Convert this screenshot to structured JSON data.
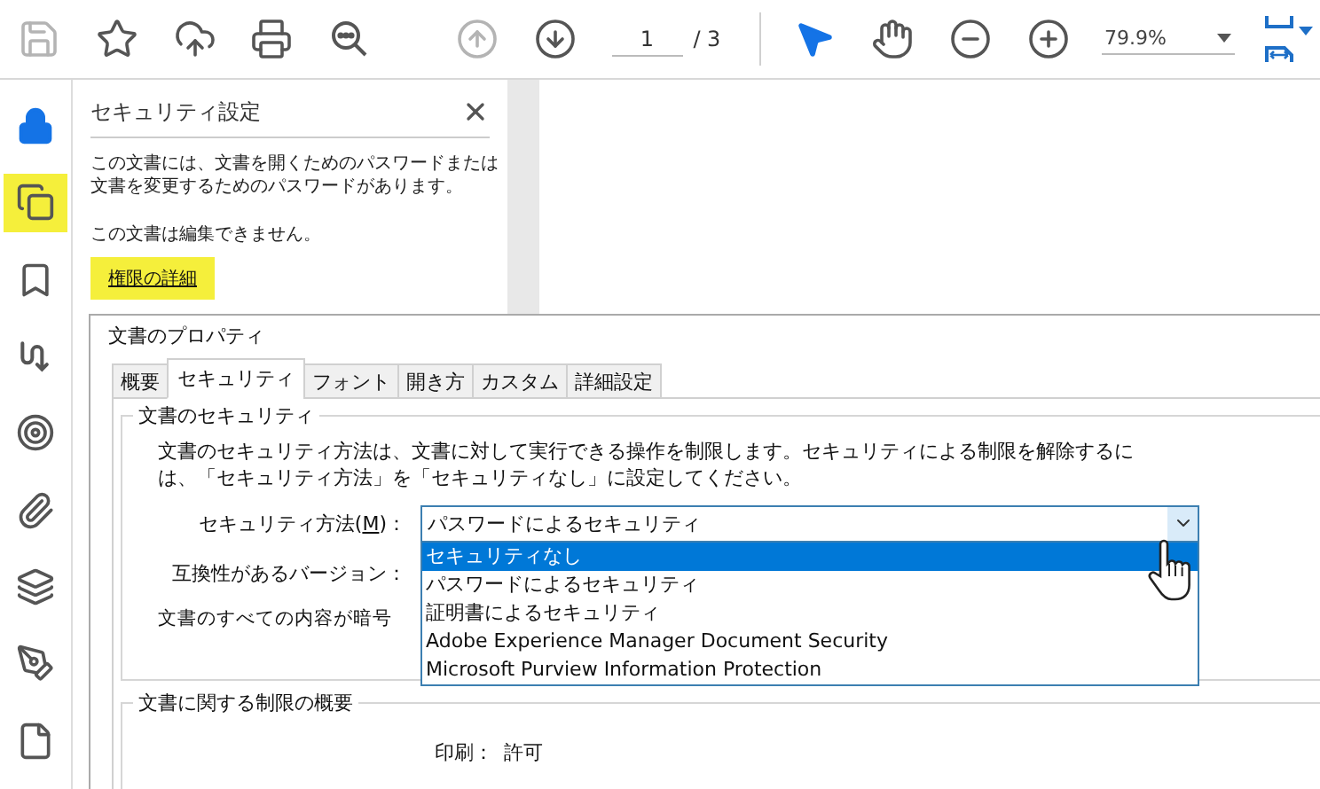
{
  "toolbar": {
    "tools": [
      {
        "kind": "save",
        "disabled": true,
        "selected": false
      },
      {
        "kind": "star",
        "disabled": false,
        "selected": false
      },
      {
        "kind": "upload",
        "disabled": false,
        "selected": false
      },
      {
        "kind": "print",
        "disabled": false,
        "selected": false
      },
      {
        "kind": "search",
        "disabled": false,
        "selected": false
      }
    ],
    "nav": [
      {
        "kind": "up",
        "disabled": true,
        "selected": false
      },
      {
        "kind": "down",
        "disabled": false,
        "selected": false
      }
    ],
    "page": {
      "current": "1",
      "total": "/ 3"
    },
    "view": [
      {
        "kind": "pointer",
        "disabled": false,
        "selected": true
      },
      {
        "kind": "hand",
        "disabled": false,
        "selected": false
      },
      {
        "kind": "zoom-out",
        "disabled": false,
        "selected": false
      },
      {
        "kind": "zoom-in",
        "disabled": false,
        "selected": false
      }
    ],
    "zoom": "79.9%"
  },
  "sidebar": {
    "items": [
      {
        "kind": "lock",
        "selected": true,
        "highlighted": false
      },
      {
        "kind": "copy",
        "selected": false,
        "highlighted": true
      },
      {
        "kind": "bookmark",
        "selected": false,
        "highlighted": false
      },
      {
        "kind": "squiggle",
        "selected": false,
        "highlighted": false
      },
      {
        "kind": "target",
        "selected": false,
        "highlighted": false
      },
      {
        "kind": "paperclip",
        "selected": false,
        "highlighted": false
      },
      {
        "kind": "layers",
        "selected": false,
        "highlighted": false
      },
      {
        "kind": "pen",
        "selected": false,
        "highlighted": false
      },
      {
        "kind": "file",
        "selected": false,
        "highlighted": false
      }
    ]
  },
  "security_panel": {
    "title": "セキュリティ設定",
    "description": "この文書には、文書を開くためのパスワードまたは文書を変更するためのパスワードがあります。",
    "note": "この文書は編集できません。",
    "link": {
      "label": "権限の詳細",
      "highlighted": true
    }
  },
  "dialog": {
    "title": "文書のプロパティ",
    "tabs": [
      {
        "label": "概要",
        "selected": false
      },
      {
        "label": "セキュリティ",
        "selected": true
      },
      {
        "label": "フォント",
        "selected": false
      },
      {
        "label": "開き方",
        "selected": false
      },
      {
        "label": "カスタム",
        "selected": false
      },
      {
        "label": "詳細設定",
        "selected": false
      }
    ],
    "security_group": {
      "title": "文書のセキュリティ",
      "description": [
        "文書のセキュリティ方法は、文書に対して実行できる操作を制限します。セキュリティによる制限を解除するに",
        "は、「セキュリティ方法」を「セキュリティなし」に設定してください。"
      ],
      "method_label": {
        "before": "セキュリティ方法(",
        "accesskey": "M",
        "after": ")："
      },
      "method_value": "パスワードによるセキュリティ",
      "options": [
        {
          "label": "セキュリティなし",
          "selected": true
        },
        {
          "label": "パスワードによるセキュリティ",
          "selected": false
        },
        {
          "label": "証明書によるセキュリティ",
          "selected": false
        },
        {
          "label": "Adobe Experience Manager Document Security",
          "selected": false
        },
        {
          "label": "Microsoft Purview Information Protection",
          "selected": false
        }
      ],
      "compat_label": "互換性があるバージョン：",
      "encrypt_label": "文書のすべての内容が暗号"
    },
    "restrictions_group": {
      "title": "文書に関する制限の概要",
      "rows": [
        {
          "label": "印刷：",
          "value": "許可"
        }
      ]
    }
  }
}
